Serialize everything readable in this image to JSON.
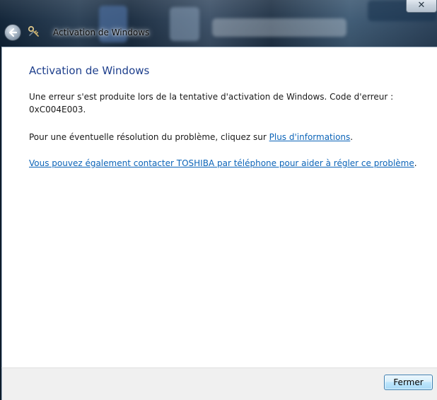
{
  "window": {
    "title": "Activation de Windows",
    "close_glyph": "✕",
    "back_icon": "back-arrow-icon",
    "app_icon": "activation-keys-icon"
  },
  "main": {
    "heading": "Activation de Windows",
    "error_message_line1": "Une erreur s'est produite lors de la tentative d'activation de Windows. Code d'erreur :",
    "error_message_line2": "0xC004E003.",
    "resolution_prefix": "Pour une éventuelle résolution du problème, cliquez sur ",
    "resolution_link": "Plus d'informations",
    "resolution_suffix": ".",
    "contact_link": "Vous pouvez également contacter TOSHIBA par téléphone pour aider à régler ce problème",
    "contact_suffix": "."
  },
  "footer": {
    "close_label": "Fermer"
  },
  "colors": {
    "heading": "#1e3f8c",
    "link": "#0c64b8",
    "footer_bg": "#f0f0f0"
  }
}
